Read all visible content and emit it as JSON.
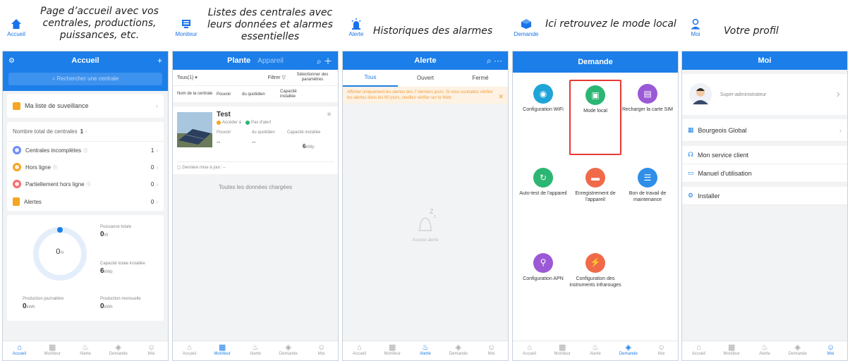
{
  "captions": [
    {
      "icon_label": "Accueil",
      "text": "Page d’accueil avec vos centrales, productions, puissances, etc."
    },
    {
      "icon_label": "Moniteur",
      "text": "Listes des centrales avec leurs données et alarmes essentielles"
    },
    {
      "icon_label": "Alerte",
      "text": "Historiques des alarmes"
    },
    {
      "icon_label": "Demande",
      "text": "Ici retrouvez le mode local"
    },
    {
      "icon_label": "Moi",
      "text": "Votre profil"
    }
  ],
  "tabs": [
    "Accueil",
    "Moniteur",
    "Alerte",
    "Demande",
    "Moi"
  ],
  "accueil": {
    "title": "Accueil",
    "search_placeholder": "Rechercher une centrale",
    "watchlist": "Ma liste de suveillance",
    "total_label": "Nombre total de centrales",
    "total_value": "1",
    "stats": [
      {
        "label": "Centrales incomplètes",
        "value": "1",
        "color": "#6c8cf5"
      },
      {
        "label": "Hors ligne",
        "value": "0",
        "color": "#f5a623"
      },
      {
        "label": "Partiellement hors ligne",
        "value": "0",
        "color": "#f56c6c"
      },
      {
        "label": "Alertes",
        "value": "0",
        "color": "#f5a623"
      }
    ],
    "gauge_value": "0",
    "gauge_unit": "%",
    "puissance_label": "Puissance totale",
    "puissance_value": "0",
    "puissance_unit": "W",
    "capacite_label": "Capacité totale installée",
    "capacite_value": "6",
    "capacite_unit": "kWp",
    "prod_jour_label": "Production journalière",
    "prod_jour_value": "0",
    "prod_jour_unit": "kWh",
    "prod_mois_label": "Production mensuelle",
    "prod_mois_value": "0",
    "prod_mois_unit": "kWh"
  },
  "moniteur": {
    "title": "Plante",
    "title2": "Appareil",
    "filter_all": "Tous(1) ▾",
    "filter": "Filtrer",
    "select_params": "Sélectionner des paramètres",
    "col1": "Nom de la centrale",
    "col2": "Pouvoir",
    "col3": "du quotidien",
    "col4": "Capacité installée",
    "plant_name": "Test",
    "access": "Accéder à",
    "no_alert": "Pas d'alert",
    "f_pouvoir": "Pouvoir",
    "f_quotidien": "du quotidien",
    "f_capacite": "Capacité installée",
    "v_pouvoir": "--",
    "v_quotidien": "--",
    "v_capacite": "6",
    "v_capacite_unit": "kWp",
    "last_update": "Dernière mise à jour: --",
    "loaded": "Toutes les données chargées"
  },
  "alerte": {
    "title": "Alerte",
    "tabs": [
      "Tous",
      "Ouvert",
      "Fermé"
    ],
    "notice": "Afficher uniquement les alertes des 7 derniers jours. Si vous souhaitez vérifier les alertes dans les 60 jours, veuillez vérifier sur le Web",
    "empty": "Aucune alerte"
  },
  "demande": {
    "title": "Demande",
    "items": [
      {
        "label": "Configuration WiFi",
        "color": "#1fa4d8"
      },
      {
        "label": "Mode local",
        "color": "#2bb673"
      },
      {
        "label": "Recharger la carte SIM",
        "color": "#9b59d6"
      },
      {
        "label": "Auto-test de l'appareil",
        "color": "#2bb673"
      },
      {
        "label": "Enregistrement de l'appareil",
        "color": "#f06a4a"
      },
      {
        "label": "Bon de travail de maintenance",
        "color": "#2f8fe8"
      },
      {
        "label": "Configuration APN",
        "color": "#9b59d6"
      },
      {
        "label": "Configuration des instruments infrarouges",
        "color": "#f06a4a"
      }
    ]
  },
  "moi": {
    "title": "Moi",
    "role": "Super-administrateur",
    "org": "Bourgeois Global",
    "service": "Mon service client",
    "manual": "Manuel d'utilisation",
    "install": "Installer"
  }
}
